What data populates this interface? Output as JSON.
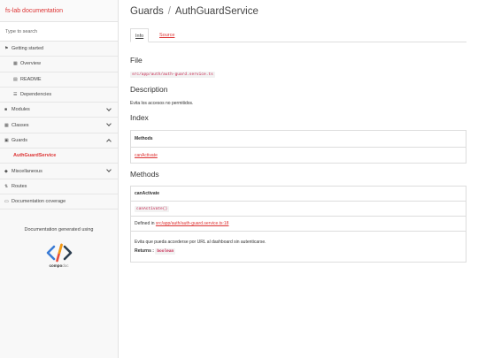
{
  "sidebar": {
    "brand": "fs-lab documentation",
    "search_placeholder": "Type to search",
    "items": [
      {
        "label": "Getting started",
        "icon": "home-icon"
      },
      {
        "label": "Overview",
        "icon": "grid-icon"
      },
      {
        "label": "README",
        "icon": "book-icon"
      },
      {
        "label": "Dependencies",
        "icon": "list-icon"
      },
      {
        "label": "Modules",
        "icon": "archive-icon"
      },
      {
        "label": "Classes",
        "icon": "file-icon"
      },
      {
        "label": "Guards",
        "icon": "lock-icon"
      },
      {
        "label": "AuthGuardService"
      },
      {
        "label": "Miscellaneous",
        "icon": "cube-icon"
      },
      {
        "label": "Routes",
        "icon": "route-icon"
      },
      {
        "label": "Documentation coverage",
        "icon": "coverage-icon"
      }
    ],
    "generated_text": "Documentation generated using",
    "logo_text_bold": "compo",
    "logo_text_light": "doc"
  },
  "main": {
    "breadcrumb_parent": "Guards",
    "breadcrumb_sep": "/",
    "title": "AuthGuardService",
    "tabs": [
      "Info",
      "Source"
    ],
    "file_heading": "File",
    "file_path": "src/app/auth/auth-guard.service.ts",
    "description_heading": "Description",
    "description": "Evita los accesos no permitidos.",
    "index_heading": "Index",
    "index_table_header": "Methods",
    "index_method": "canActivate",
    "methods_heading": "Methods",
    "method_name": "canActivate",
    "method_signature": "canActivate()",
    "defined_in_label": "Defined in",
    "defined_in_link": "src/app/auth/auth-guard.service.ts:18",
    "method_description": "Evita que pueda accederse por URL al dashboard sin autenticarse.",
    "returns_label": "Returns :",
    "returns_type": "boolean"
  },
  "colors": {
    "accent": "#dd3333",
    "sidebar_bg": "#f8f8f8"
  }
}
